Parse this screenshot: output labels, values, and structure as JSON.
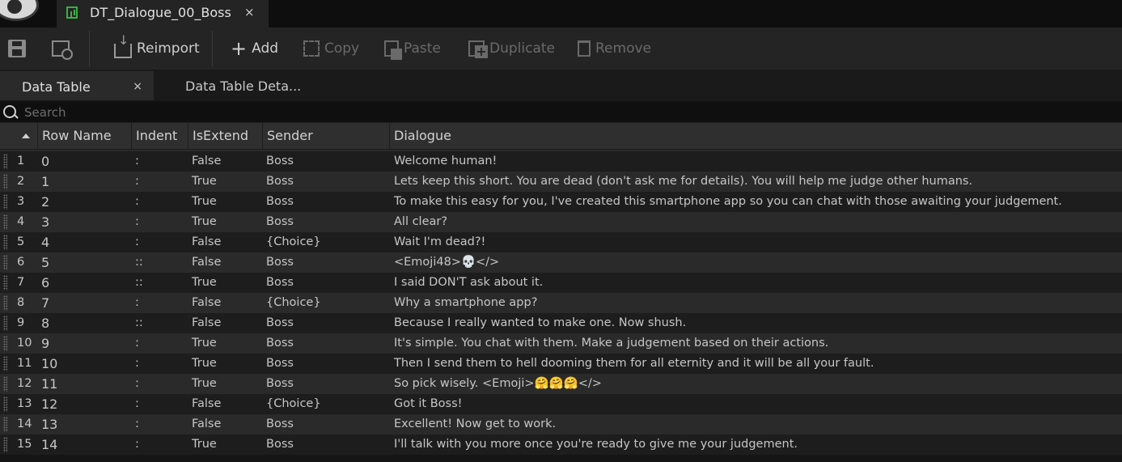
{
  "document_tab": {
    "title": "DT_Dialogue_00_Boss",
    "close": "×"
  },
  "toolbar": {
    "reimport": "Reimport",
    "add": "Add",
    "copy": "Copy",
    "paste": "Paste",
    "duplicate": "Duplicate",
    "remove": "Remove"
  },
  "panel_tabs": [
    {
      "label": "Data Table",
      "close": "×",
      "active": true
    },
    {
      "label": "Data Table Deta...",
      "active": false
    }
  ],
  "search": {
    "placeholder": "Search",
    "value": ""
  },
  "table": {
    "columns": [
      "Row Name",
      "Indent",
      "IsExtend",
      "Sender",
      "Dialogue"
    ],
    "rows": [
      {
        "index": "1",
        "name": "0",
        "indent": ":",
        "extend": "False",
        "sender": "Boss",
        "dialogue": "Welcome human!"
      },
      {
        "index": "2",
        "name": "1",
        "indent": ":",
        "extend": "True",
        "sender": "Boss",
        "dialogue": "Lets keep this short. You are dead (don't ask me for details). You will help me judge other humans."
      },
      {
        "index": "3",
        "name": "2",
        "indent": ":",
        "extend": "True",
        "sender": "Boss",
        "dialogue": "To make this easy for you, I've created this smartphone app so you can chat with those awaiting your judgement."
      },
      {
        "index": "4",
        "name": "3",
        "indent": ":",
        "extend": "True",
        "sender": "Boss",
        "dialogue": "All clear?"
      },
      {
        "index": "5",
        "name": "4",
        "indent": ":",
        "extend": "False",
        "sender": "{Choice}",
        "dialogue": "Wait I'm dead?!"
      },
      {
        "index": "6",
        "name": "5",
        "indent": "::",
        "extend": "False",
        "sender": "Boss",
        "dialogue": "<Emoji48>💀</>"
      },
      {
        "index": "7",
        "name": "6",
        "indent": "::",
        "extend": "True",
        "sender": "Boss",
        "dialogue": "I said DON'T ask about it."
      },
      {
        "index": "8",
        "name": "7",
        "indent": ":",
        "extend": "False",
        "sender": "{Choice}",
        "dialogue": "Why a smartphone app?"
      },
      {
        "index": "9",
        "name": "8",
        "indent": "::",
        "extend": "False",
        "sender": "Boss",
        "dialogue": "Because I really wanted to make one. Now shush."
      },
      {
        "index": "10",
        "name": "9",
        "indent": ":",
        "extend": "True",
        "sender": "Boss",
        "dialogue": "It's simple. You chat with them. Make a judgement based on their actions."
      },
      {
        "index": "11",
        "name": "10",
        "indent": ":",
        "extend": "True",
        "sender": "Boss",
        "dialogue": "Then I send them to hell dooming them for all eternity and it will be all your fault."
      },
      {
        "index": "12",
        "name": "11",
        "indent": ":",
        "extend": "True",
        "sender": "Boss",
        "dialogue": "So pick wisely. <Emoji>🤗🤗🤗</>"
      },
      {
        "index": "13",
        "name": "12",
        "indent": ":",
        "extend": "False",
        "sender": "{Choice}",
        "dialogue": "Got it Boss!"
      },
      {
        "index": "14",
        "name": "13",
        "indent": ":",
        "extend": "False",
        "sender": "Boss",
        "dialogue": "Excellent! Now get to work."
      },
      {
        "index": "15",
        "name": "14",
        "indent": ":",
        "extend": "True",
        "sender": "Boss",
        "dialogue": " I'll talk with you more once you're ready to give me your judgement."
      }
    ]
  }
}
